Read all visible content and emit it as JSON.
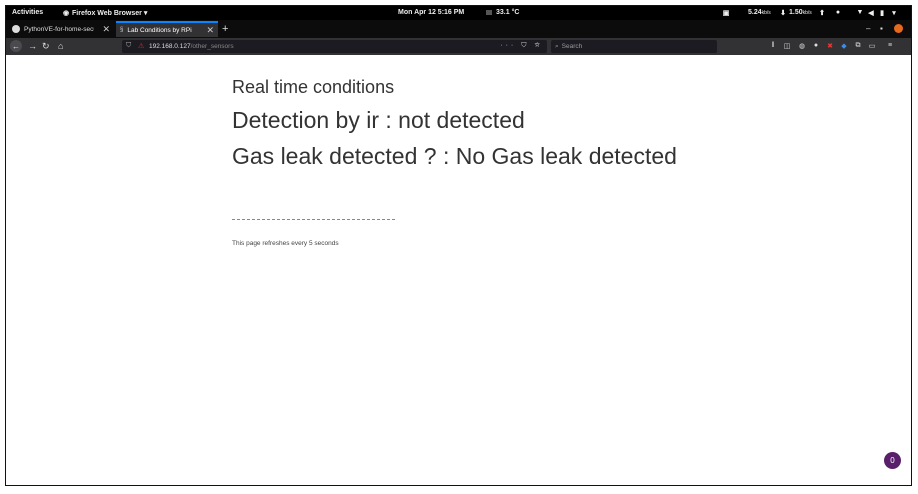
{
  "system_bar": {
    "activities": "Activities",
    "app_menu": "Firefox Web Browser",
    "app_menu_caret": "▾",
    "clock": "Mon Apr 12  5:16 PM",
    "temperature": "33.1 °C",
    "net_down": "5.24",
    "net_down_unit": "kb/s",
    "net_up": "1.50",
    "net_up_unit": "kb/s"
  },
  "tabs": [
    {
      "label": "PythonVE-for-home-secur",
      "icon": "github-icon",
      "active": false
    },
    {
      "label": "Lab Conditions by RPi",
      "icon": "page-icon",
      "active": true
    }
  ],
  "new_tab_label": "+",
  "address_bar": {
    "host": "192.168.0.127",
    "path": "/other_sensors",
    "page_actions": "··· ⛉ ☆"
  },
  "search_bar": {
    "placeholder": "Search"
  },
  "page": {
    "heading": "Real time conditions",
    "ir_status": "Detection by ir : not detected",
    "gas_status": "Gas leak detected ? : No Gas leak detected",
    "refresh_note": "This page refreshes every 5 seconds"
  },
  "notification_badge": "0",
  "colors": {
    "accent": "#0a84ff",
    "badge": "#5a1f6b",
    "window_close": "#e66a1c"
  }
}
